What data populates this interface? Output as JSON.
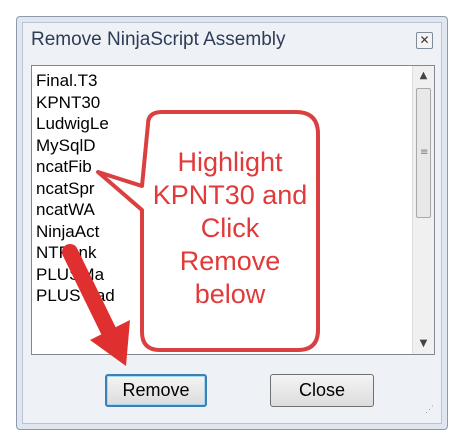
{
  "dialog": {
    "title": "Remove NinjaScript Assembly",
    "close_icon": "close-icon"
  },
  "list": {
    "items": [
      "Final.T3",
      "KPNT30",
      "LudwigLe",
      "MySqlD",
      "ncatFib",
      "ncatSpr",
      "ncatWA",
      "NinjaAct",
      "NTFunk",
      "PLUSMa",
      "PLUSTrad"
    ]
  },
  "buttons": {
    "remove": "Remove",
    "close": "Close"
  },
  "annotation": {
    "lines": [
      "Highlight",
      "KPNT30 and",
      "Click",
      "Remove",
      "below"
    ],
    "color": "#e03a3a"
  }
}
